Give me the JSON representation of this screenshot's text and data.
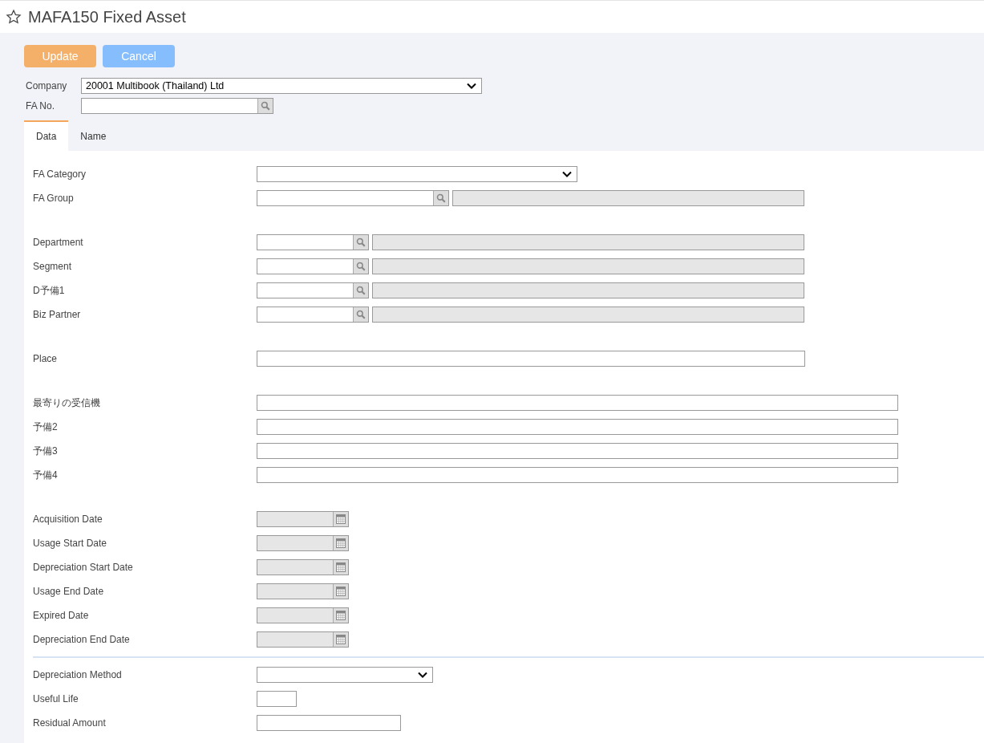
{
  "title": "MAFA150 Fixed Asset",
  "buttons": [
    {
      "label": "Update",
      "kind": "update"
    },
    {
      "label": "Cancel",
      "kind": "cancel"
    }
  ],
  "header_fields": [
    {
      "label": "Company",
      "kind": "select",
      "value": "20001 Multibook (Thailand) Ltd"
    },
    {
      "label": "FA No.",
      "kind": "lookup"
    }
  ],
  "tabs": [
    {
      "label": "Data",
      "selected": true
    },
    {
      "label": "Name",
      "selected": false
    }
  ],
  "groups": [
    {
      "divider": false,
      "rows": [
        {
          "label": "FA Category",
          "kind": "select"
        },
        {
          "label": "FA Group",
          "kind": "lookup"
        }
      ]
    },
    {
      "divider": false,
      "rows": [
        {
          "label": "Department",
          "kind": "lookup"
        },
        {
          "label": "Segment",
          "kind": "lookup"
        },
        {
          "label": "D予備1",
          "kind": "lookup"
        },
        {
          "label": "Biz Partner",
          "kind": "lookup"
        }
      ]
    },
    {
      "divider": false,
      "rows": [
        {
          "label": "Place",
          "kind": "text"
        }
      ]
    },
    {
      "divider": false,
      "rows": [
        {
          "label": "最寄りの受信機",
          "kind": "text"
        },
        {
          "label": "予備2",
          "kind": "text"
        },
        {
          "label": "予備3",
          "kind": "text"
        },
        {
          "label": "予備4",
          "kind": "text"
        }
      ]
    },
    {
      "divider": false,
      "rows": [
        {
          "label": "Acquisition Date",
          "kind": "date",
          "disabled": true
        },
        {
          "label": "Usage Start Date",
          "kind": "date",
          "disabled": true
        },
        {
          "label": "Depreciation Start Date",
          "kind": "date",
          "disabled": true
        },
        {
          "label": "Usage End Date",
          "kind": "date",
          "disabled": true
        },
        {
          "label": "Expired Date",
          "kind": "date",
          "disabled": true
        },
        {
          "label": "Depreciation End Date",
          "kind": "date",
          "disabled": true
        }
      ]
    },
    {
      "divider": true,
      "rows": [
        {
          "label": "Depreciation Method",
          "kind": "select"
        },
        {
          "label": "Useful Life",
          "kind": "text"
        },
        {
          "label": "Residual Amount",
          "kind": "text"
        }
      ]
    }
  ]
}
